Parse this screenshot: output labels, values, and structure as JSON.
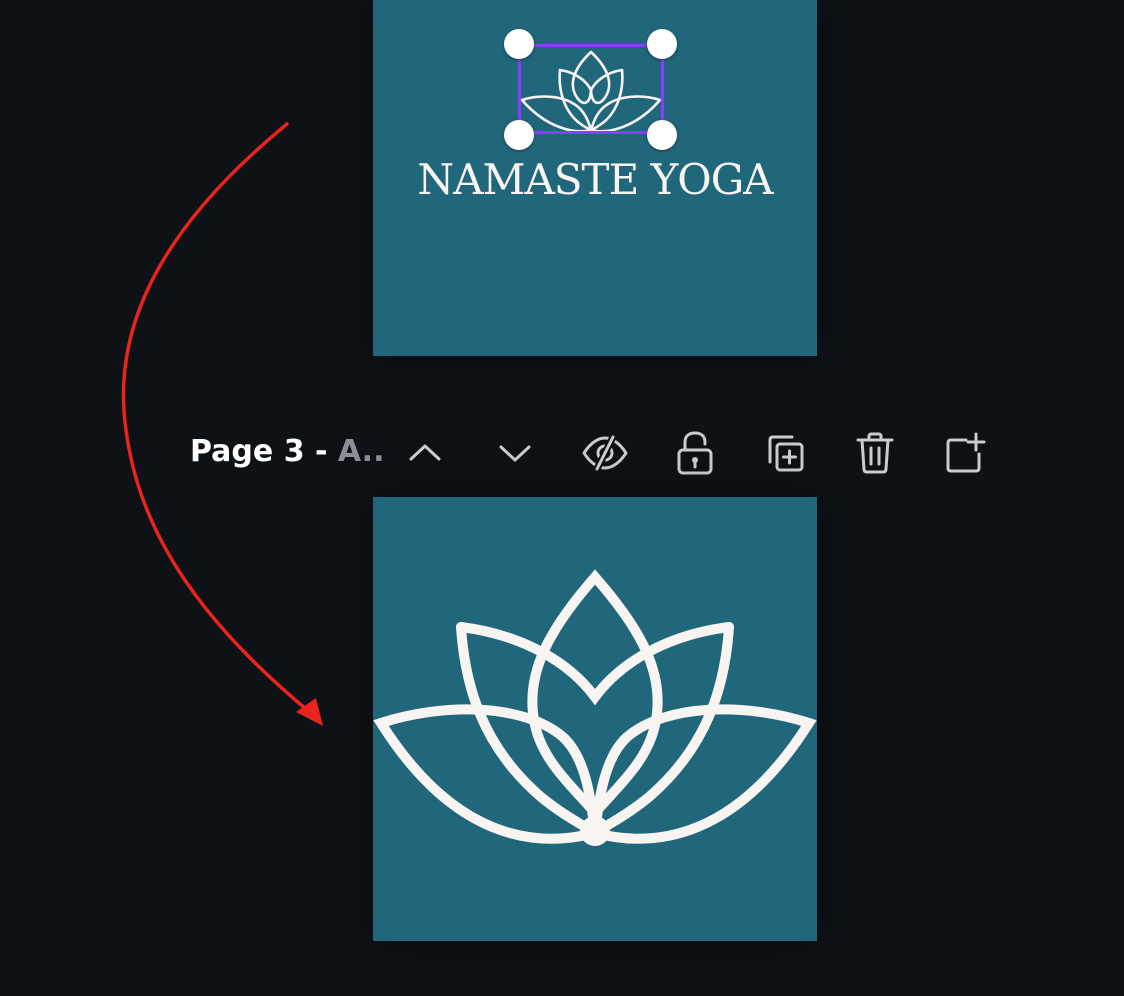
{
  "design": {
    "top_page": {
      "title": "NAMASTE YOGA",
      "background": "#20677c"
    },
    "bottom_page": {
      "background": "#20677c"
    }
  },
  "page_toolbar": {
    "page_number": "Page 3 - ",
    "page_name": "A..",
    "buttons": [
      {
        "name": "move-page-up-button",
        "icon": "chevron-up-icon"
      },
      {
        "name": "move-page-down-button",
        "icon": "chevron-down-icon"
      },
      {
        "name": "hide-page-button",
        "icon": "eye-slash-icon"
      },
      {
        "name": "lock-page-button",
        "icon": "unlock-icon"
      },
      {
        "name": "duplicate-page-button",
        "icon": "duplicate-icon"
      },
      {
        "name": "delete-page-button",
        "icon": "trash-icon"
      },
      {
        "name": "add-page-button",
        "icon": "add-page-icon"
      }
    ]
  },
  "colors": {
    "canvas_background": "#0e1116",
    "page_background": "#20677c",
    "selection": "#8b3dff",
    "annotation_arrow": "#e8241c",
    "lotus_stroke": "#f7f4f1"
  }
}
